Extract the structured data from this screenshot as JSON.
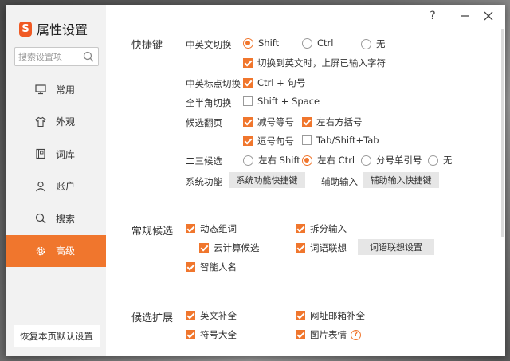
{
  "window": {
    "title": "属性设置"
  },
  "titlebar": {
    "help": "?"
  },
  "search": {
    "placeholder": "搜索设置项"
  },
  "sidebar": {
    "items": [
      {
        "label": "常用",
        "icon": "monitor-icon"
      },
      {
        "label": "外观",
        "icon": "shirt-icon"
      },
      {
        "label": "词库",
        "icon": "book-icon"
      },
      {
        "label": "账户",
        "icon": "user-icon"
      },
      {
        "label": "搜索",
        "icon": "search-icon"
      },
      {
        "label": "高级",
        "icon": "gear-icon",
        "active": true
      }
    ],
    "restore_label": "恢复本页默认设置"
  },
  "shortcuts": {
    "title": "快捷键",
    "cn_en_switch": {
      "label": "中英文切换",
      "options": [
        "Shift",
        "Ctrl",
        "无"
      ],
      "selected": "Shift",
      "sub_option": "切换到英文时，上屏已输入字符",
      "sub_checked": true
    },
    "punct_switch": {
      "label": "中英标点切换",
      "option": "Ctrl + 句号",
      "checked": true
    },
    "width_switch": {
      "label": "全半角切换",
      "option": "Shift + Space",
      "checked": false
    },
    "page_flip": {
      "label": "候选翻页",
      "options": [
        {
          "label": "减号等号",
          "checked": true
        },
        {
          "label": "左右方括号",
          "checked": true
        },
        {
          "label": "逗号句号",
          "checked": true
        },
        {
          "label": "Tab/Shift+Tab",
          "checked": false
        }
      ]
    },
    "second_third": {
      "label": "二三候选",
      "options": [
        "左右 Shift",
        "左右 Ctrl",
        "分号单引号",
        "无"
      ],
      "selected": "左右 Ctrl"
    },
    "system_func": {
      "label": "系统功能",
      "button": "系统功能快捷键"
    },
    "aux_input": {
      "label": "辅助输入",
      "button": "辅助输入快捷键"
    }
  },
  "common_candidates": {
    "title": "常规候选",
    "options": [
      {
        "label": "动态组词",
        "checked": true
      },
      {
        "label": "拆分输入",
        "checked": true
      },
      {
        "label": "云计算候选",
        "checked": true
      },
      {
        "label": "词语联想",
        "checked": true
      },
      {
        "label": "智能人名",
        "checked": true
      }
    ],
    "assoc_button": "词语联想设置"
  },
  "candidate_ext": {
    "title": "候选扩展",
    "options": [
      {
        "label": "英文补全",
        "checked": true
      },
      {
        "label": "网址邮箱补全",
        "checked": true
      },
      {
        "label": "符号大全",
        "checked": true
      },
      {
        "label": "图片表情",
        "checked": true
      }
    ]
  },
  "colors": {
    "accent": "#f0762d",
    "sidebar_bg": "#f2f2f2"
  }
}
